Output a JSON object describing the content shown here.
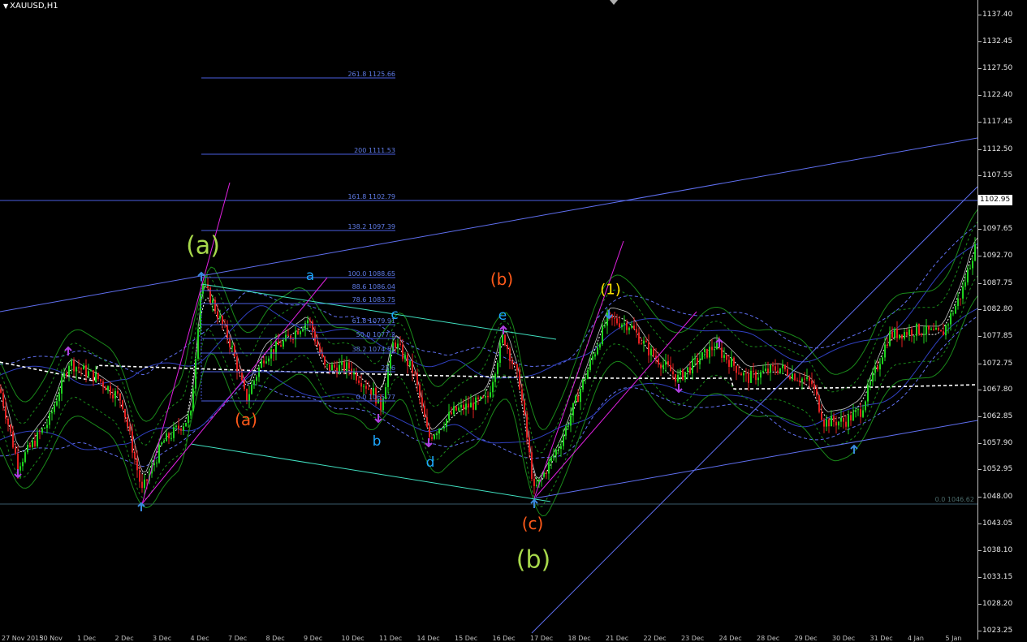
{
  "window": {
    "title": "XAUUSD,H1",
    "menu_arrow": "dropdown-arrow-icon"
  },
  "colors": {
    "background": "#000000",
    "bull_candle": "#1fd31f",
    "bear_candle": "#e02020",
    "fib_line": "#4a5ee0",
    "channel_line": "#5f6ff0",
    "magenta": "#e020e0",
    "cyan_line": "#40e0c0",
    "green_band": "#1a8a1a",
    "wave_lime": "#a7d84b",
    "wave_orange": "#ff5a1a",
    "wave_cyan": "#1ea8ff",
    "wave_yellow": "#ffe000"
  },
  "price_axis": {
    "ticks": [
      "1137.40",
      "1132.45",
      "1127.50",
      "1122.40",
      "1117.45",
      "1112.50",
      "1107.55",
      "1102.95",
      "1097.65",
      "1092.70",
      "1087.75",
      "1082.80",
      "1077.85",
      "1072.75",
      "1067.80",
      "1062.85",
      "1057.90",
      "1052.95",
      "1048.00",
      "1043.05",
      "1038.10",
      "1033.15",
      "1028.20",
      "1023.25"
    ],
    "current_price": "1102.95"
  },
  "fibonacci": {
    "levels": [
      {
        "label": "261.8 1125.66"
      },
      {
        "label": "200 1111.53"
      },
      {
        "label": "161.8 1102.79"
      },
      {
        "label": "138.2 1097.39"
      },
      {
        "label": "100.0 1088.65"
      },
      {
        "label": "88.6 1086.04"
      },
      {
        "label": "78.6 1083.75"
      },
      {
        "label": "61.8 1079.91"
      },
      {
        "label": "50.0 1077.2"
      },
      {
        "label": "38.2 1074.51"
      },
      {
        "label": "23.6"
      },
      {
        "label": "0.0 1065.77"
      }
    ],
    "extra_label": "0.0 1046.62"
  },
  "waves": [
    {
      "text": "(a)",
      "color": "wave_lime",
      "size": 30
    },
    {
      "text": "(b)",
      "color": "wave_lime",
      "size": 30
    },
    {
      "text": "(a)",
      "color": "wave_orange",
      "size": 20
    },
    {
      "text": "(b)",
      "color": "wave_orange",
      "size": 20
    },
    {
      "text": "(c)",
      "color": "wave_orange",
      "size": 20
    },
    {
      "text": "a",
      "color": "wave_cyan",
      "size": 17
    },
    {
      "text": "b",
      "color": "wave_cyan",
      "size": 17
    },
    {
      "text": "c",
      "color": "wave_cyan",
      "size": 17
    },
    {
      "text": "d",
      "color": "wave_cyan",
      "size": 17
    },
    {
      "text": "e",
      "color": "wave_cyan",
      "size": 17
    },
    {
      "text": "(1)",
      "color": "wave_yellow",
      "size": 18
    }
  ],
  "date_axis": [
    "27 Nov 2015",
    "30 Nov",
    "1 Dec",
    "2 Dec",
    "3 Dec",
    "4 Dec",
    "7 Dec",
    "8 Dec",
    "9 Dec",
    "10 Dec",
    "11 Dec",
    "14 Dec",
    "15 Dec",
    "16 Dec",
    "17 Dec",
    "18 Dec",
    "21 Dec",
    "22 Dec",
    "23 Dec",
    "24 Dec",
    "28 Dec",
    "29 Dec",
    "30 Dec",
    "31 Dec",
    "4 Jan",
    "5 Jan"
  ]
}
